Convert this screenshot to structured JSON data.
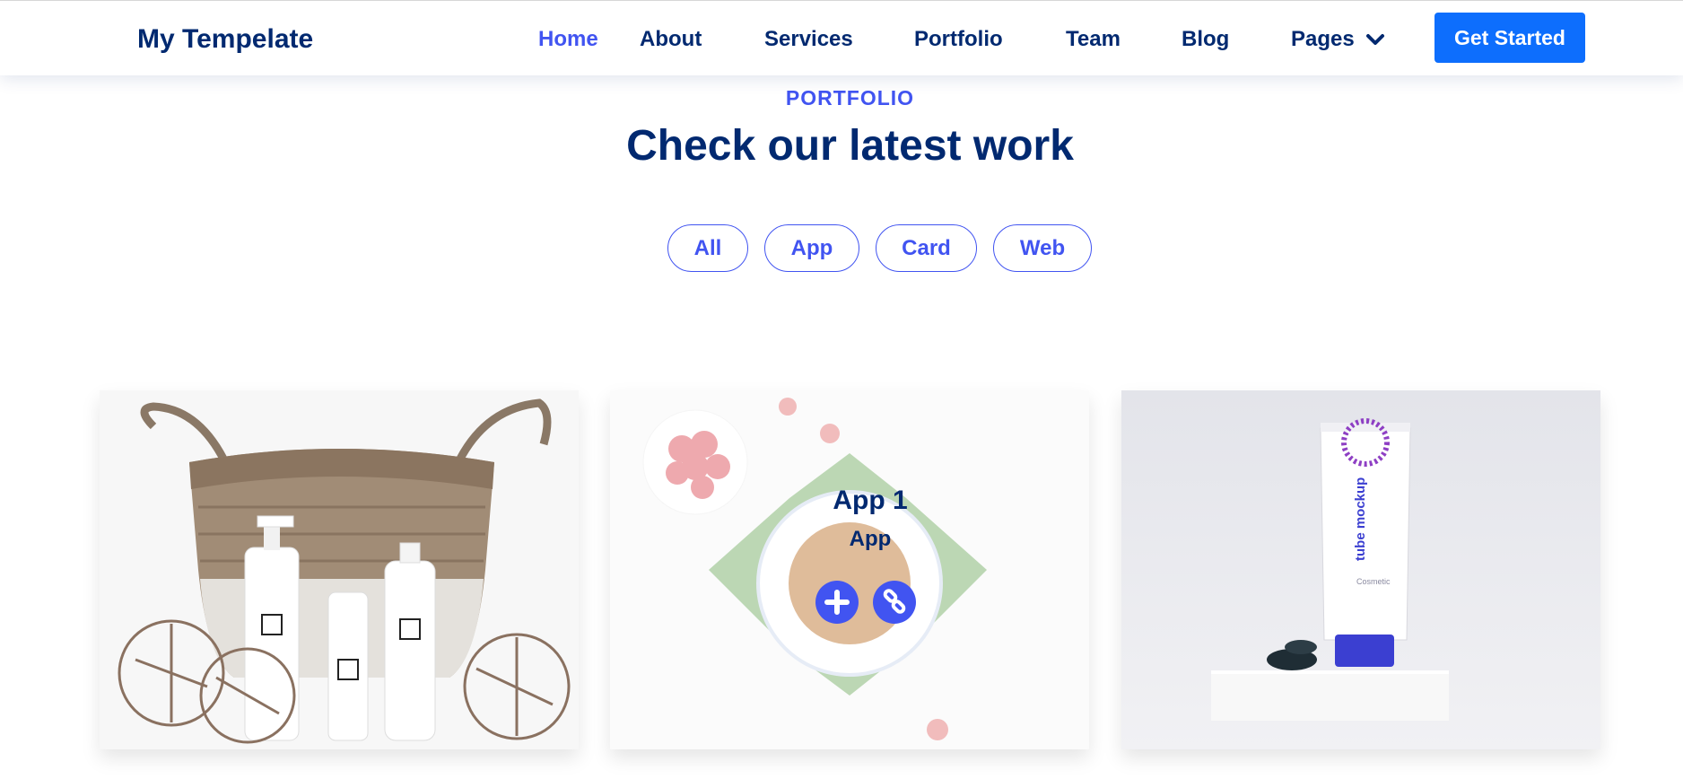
{
  "header": {
    "logo": "My Tempelate",
    "nav": [
      "Home",
      "About",
      "Services",
      "Portfolio",
      "Team",
      "Blog",
      "Pages"
    ],
    "active_nav": "Home",
    "cta": "Get Started"
  },
  "section": {
    "eyebrow": "PORTFOLIO",
    "title": "Check our latest work"
  },
  "filters": [
    "All",
    "App",
    "Card",
    "Web"
  ],
  "cards": [
    {
      "kind": "photo",
      "icon": "basket-cosmetics-image"
    },
    {
      "kind": "photo",
      "icon": "tea-cup-image",
      "hover_title": "App 1",
      "hover_category": "App"
    },
    {
      "kind": "photo",
      "icon": "tube-mockup-image",
      "product_text": "tube mockup",
      "product_subtext": "Cosmetic"
    }
  ],
  "icons": {
    "dropdown": "chevron-down-icon",
    "zoom": "plus-icon",
    "details": "link-icon"
  },
  "colors": {
    "brand_dark": "#012970",
    "accent": "#4154f1",
    "cta": "#0d6efd"
  }
}
